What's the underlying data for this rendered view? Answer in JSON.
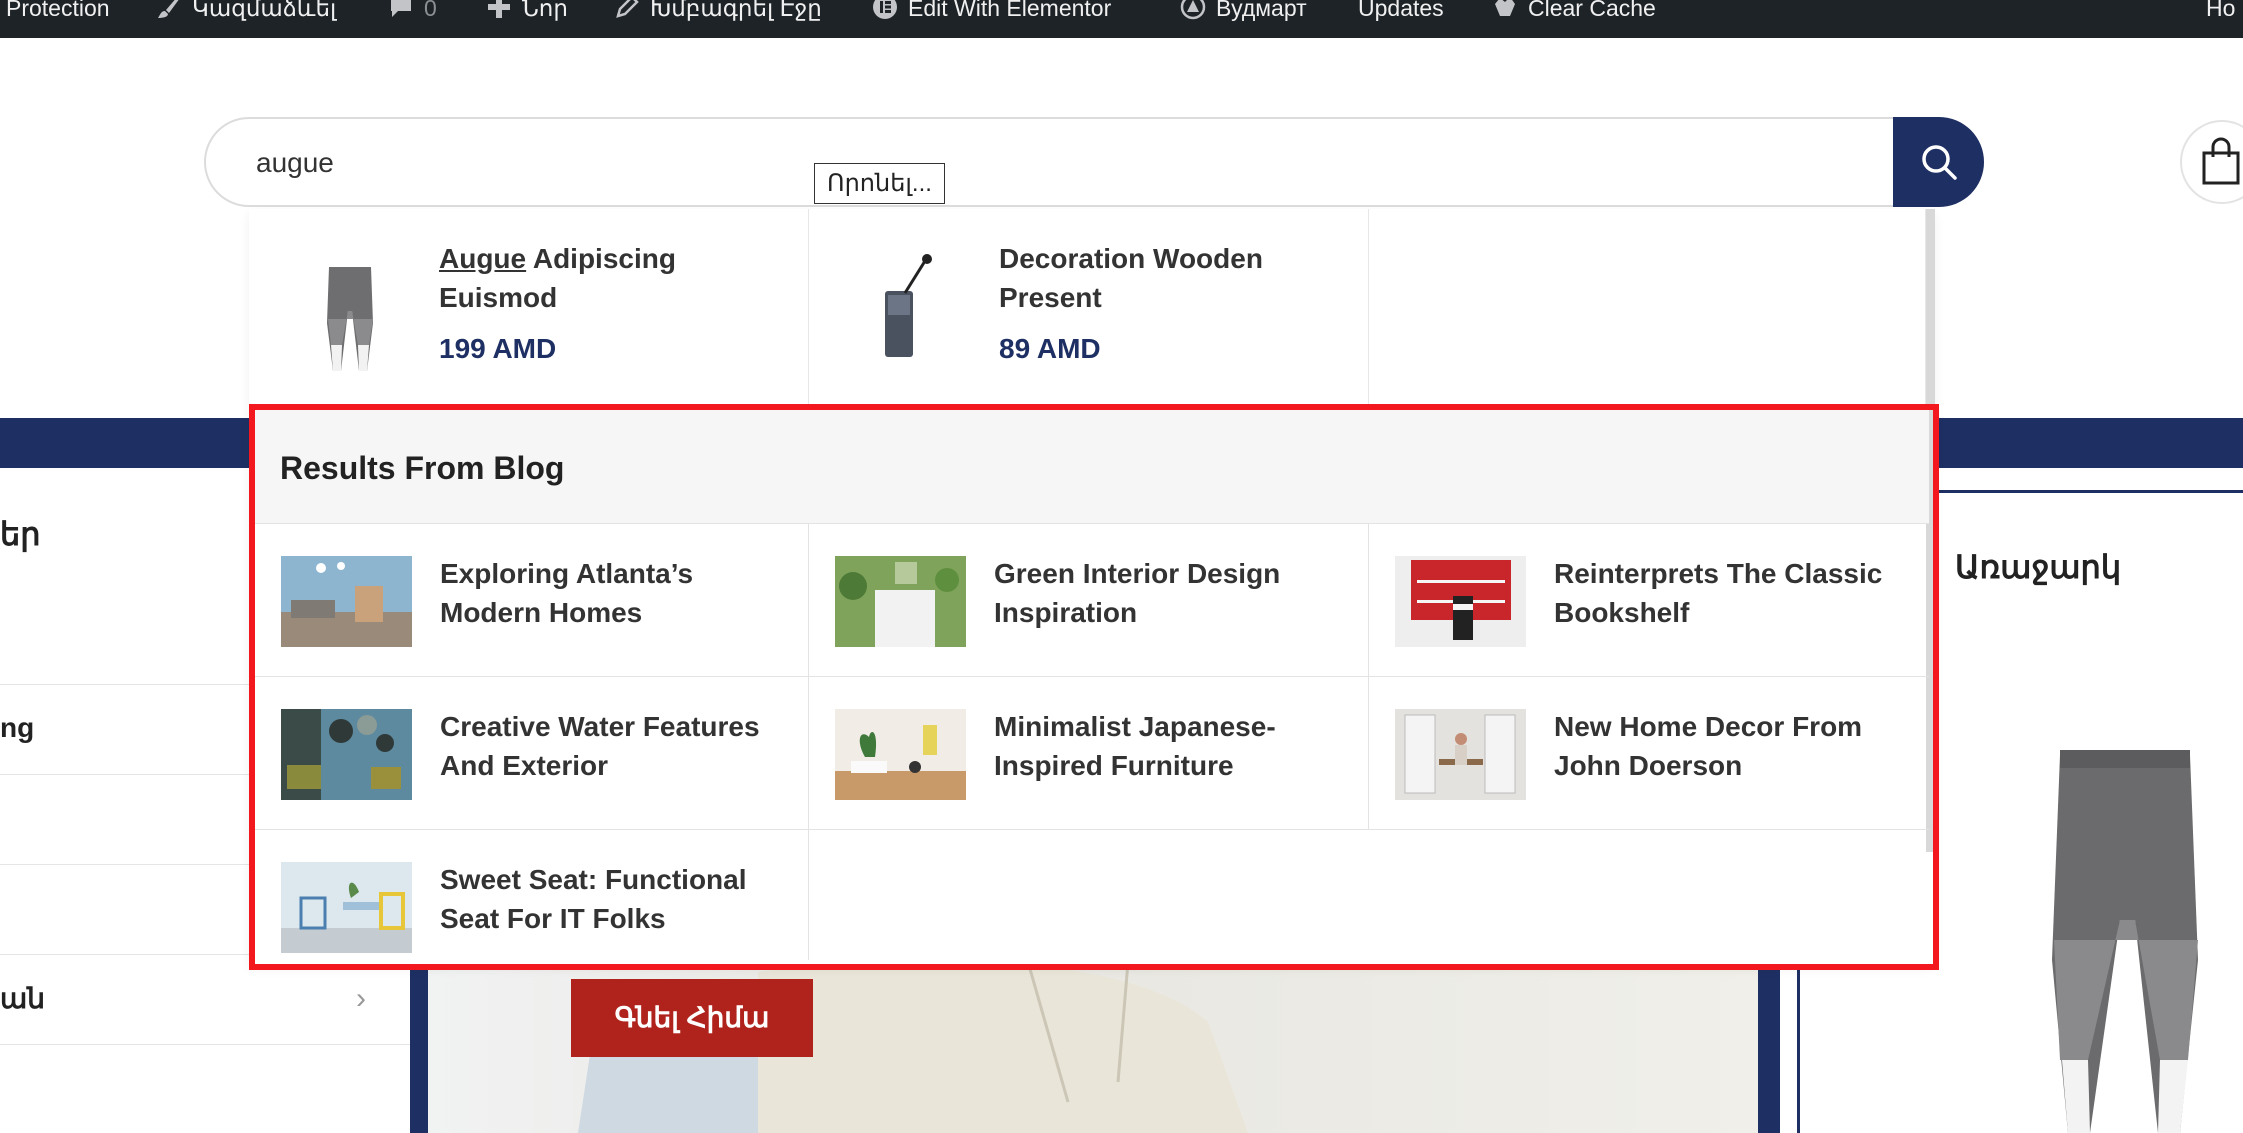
{
  "adminbar": {
    "items": [
      {
        "label": "Protection",
        "icon": "shield-icon"
      },
      {
        "label": "Կազմաձևել",
        "icon": "brush-icon"
      },
      {
        "label": "0",
        "icon": "comment-icon"
      },
      {
        "label": "Նոր",
        "icon": "plus-icon"
      },
      {
        "label": "Խմբագրել Էջը",
        "icon": "pencil-icon"
      },
      {
        "label": "Edit With Elementor",
        "icon": "elementor-icon"
      },
      {
        "label": "Вудмарт",
        "icon": "woodmart-icon"
      },
      {
        "label": "Updates",
        "icon": ""
      },
      {
        "label": "Clear Cache",
        "icon": "cache-icon"
      },
      {
        "label": "Ho",
        "icon": ""
      }
    ]
  },
  "search": {
    "value": "augue",
    "tooltip": "Որոնել...",
    "button_icon": "search-icon"
  },
  "cart_icon": "shopping-bag-icon",
  "products": [
    {
      "title_match": "Augue",
      "title_rest": " Adipiscing Euismod",
      "price": "199 AMD"
    },
    {
      "title_match": "",
      "title_rest": "Decoration Wooden Present",
      "price": "89 AMD"
    }
  ],
  "blog": {
    "heading": "Results From Blog",
    "posts": [
      {
        "title": "Exploring Atlanta’s Modern Homes"
      },
      {
        "title": "Green Interior Design Inspiration"
      },
      {
        "title": "Reinterprets The Classic Bookshelf"
      },
      {
        "title": "Creative Water Features And Exterior"
      },
      {
        "title": "Minimalist Japanese-Inspired Furniture"
      },
      {
        "title": "New Home Decor From John Doerson"
      },
      {
        "title": "Sweet Seat: Functional Seat For IT Folks"
      }
    ]
  },
  "background": {
    "categories_title": "եր",
    "categories": [
      "ng",
      "ան"
    ],
    "offer_title": "Առաջարկ",
    "shop_button": "Գնել Հիմա"
  },
  "colors": {
    "brand_navy": "#1e2f63",
    "price_navy": "#1e2f63",
    "highlight_red": "#f3181e",
    "shop_red": "#b0231c",
    "adminbar": "#1d2327"
  }
}
